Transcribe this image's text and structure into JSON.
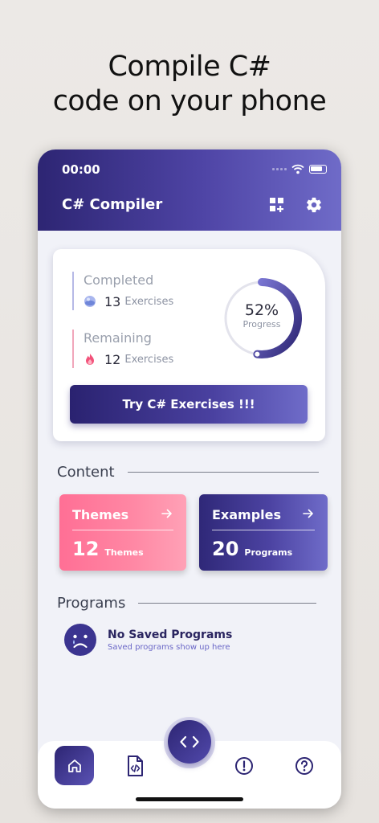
{
  "headline": {
    "line1": "Compile C#",
    "line2": "code on your phone"
  },
  "status_bar": {
    "time": "00:00"
  },
  "app_bar": {
    "title": "C# Compiler"
  },
  "stats": {
    "completed_label": "Completed",
    "completed_count": "13",
    "completed_unit": "Exercises",
    "remaining_label": "Remaining",
    "remaining_count": "12",
    "remaining_unit": "Exercises",
    "progress_text": "52%",
    "progress_fraction": 0.52,
    "progress_label": "Progress",
    "button_label": "Try C# Exercises !!!"
  },
  "content": {
    "title": "Content",
    "tiles": [
      {
        "title": "Themes",
        "count": "12",
        "unit": "Themes"
      },
      {
        "title": "Examples",
        "count": "20",
        "unit": "Programs"
      }
    ]
  },
  "programs": {
    "title": "Programs",
    "empty_title": "No Saved Programs",
    "empty_subtitle": "Saved programs show up here"
  },
  "colors": {
    "primary": "#2d2573",
    "accent": "#6f6cc9",
    "pink": "#ff6f95",
    "background": "#f1f2f8"
  },
  "icons": {
    "status": [
      "signal-icon",
      "wifi-icon",
      "battery-icon"
    ],
    "app_bar": [
      "dashboard-add-icon",
      "gear-icon"
    ],
    "nav": [
      "home-icon",
      "code-file-icon",
      "code-icon",
      "info-icon",
      "help-icon"
    ]
  }
}
